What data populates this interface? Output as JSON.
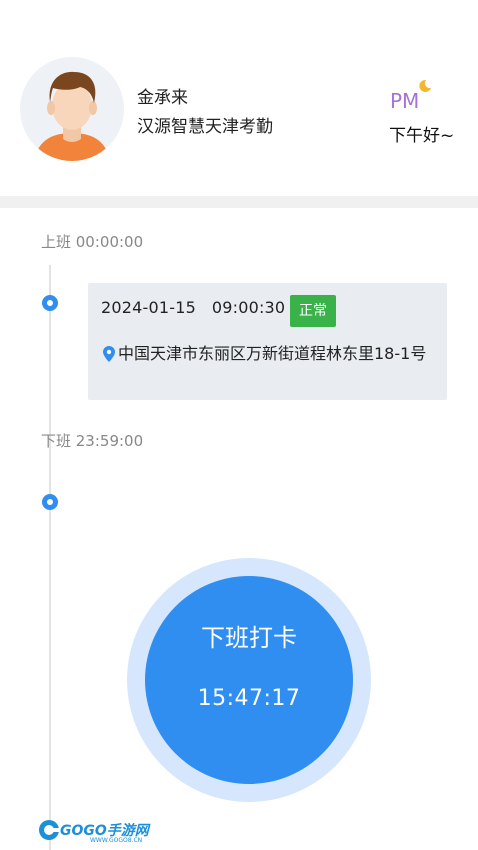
{
  "user": {
    "name": "金承来",
    "organization": "汉源智慧天津考勤"
  },
  "greeting": {
    "period_icon_text": "PM",
    "text": "下午好~"
  },
  "on_duty": {
    "label": "上班 00:00:00",
    "record_time": "2024-01-15   09:00:30",
    "status": "正常",
    "address": "中国天津市东丽区万新街道程林东里18-1号"
  },
  "off_duty": {
    "label": "下班 23:59:00"
  },
  "punch": {
    "button_label": "下班打卡",
    "current_time": "15:47:17"
  },
  "watermark": {
    "text": "GOGO手游网",
    "sub": "WWW.GOGO8.CN"
  },
  "colors": {
    "accent": "#2f8ef0",
    "status_ok": "#39b24a",
    "pm_purple": "#a772d8"
  }
}
